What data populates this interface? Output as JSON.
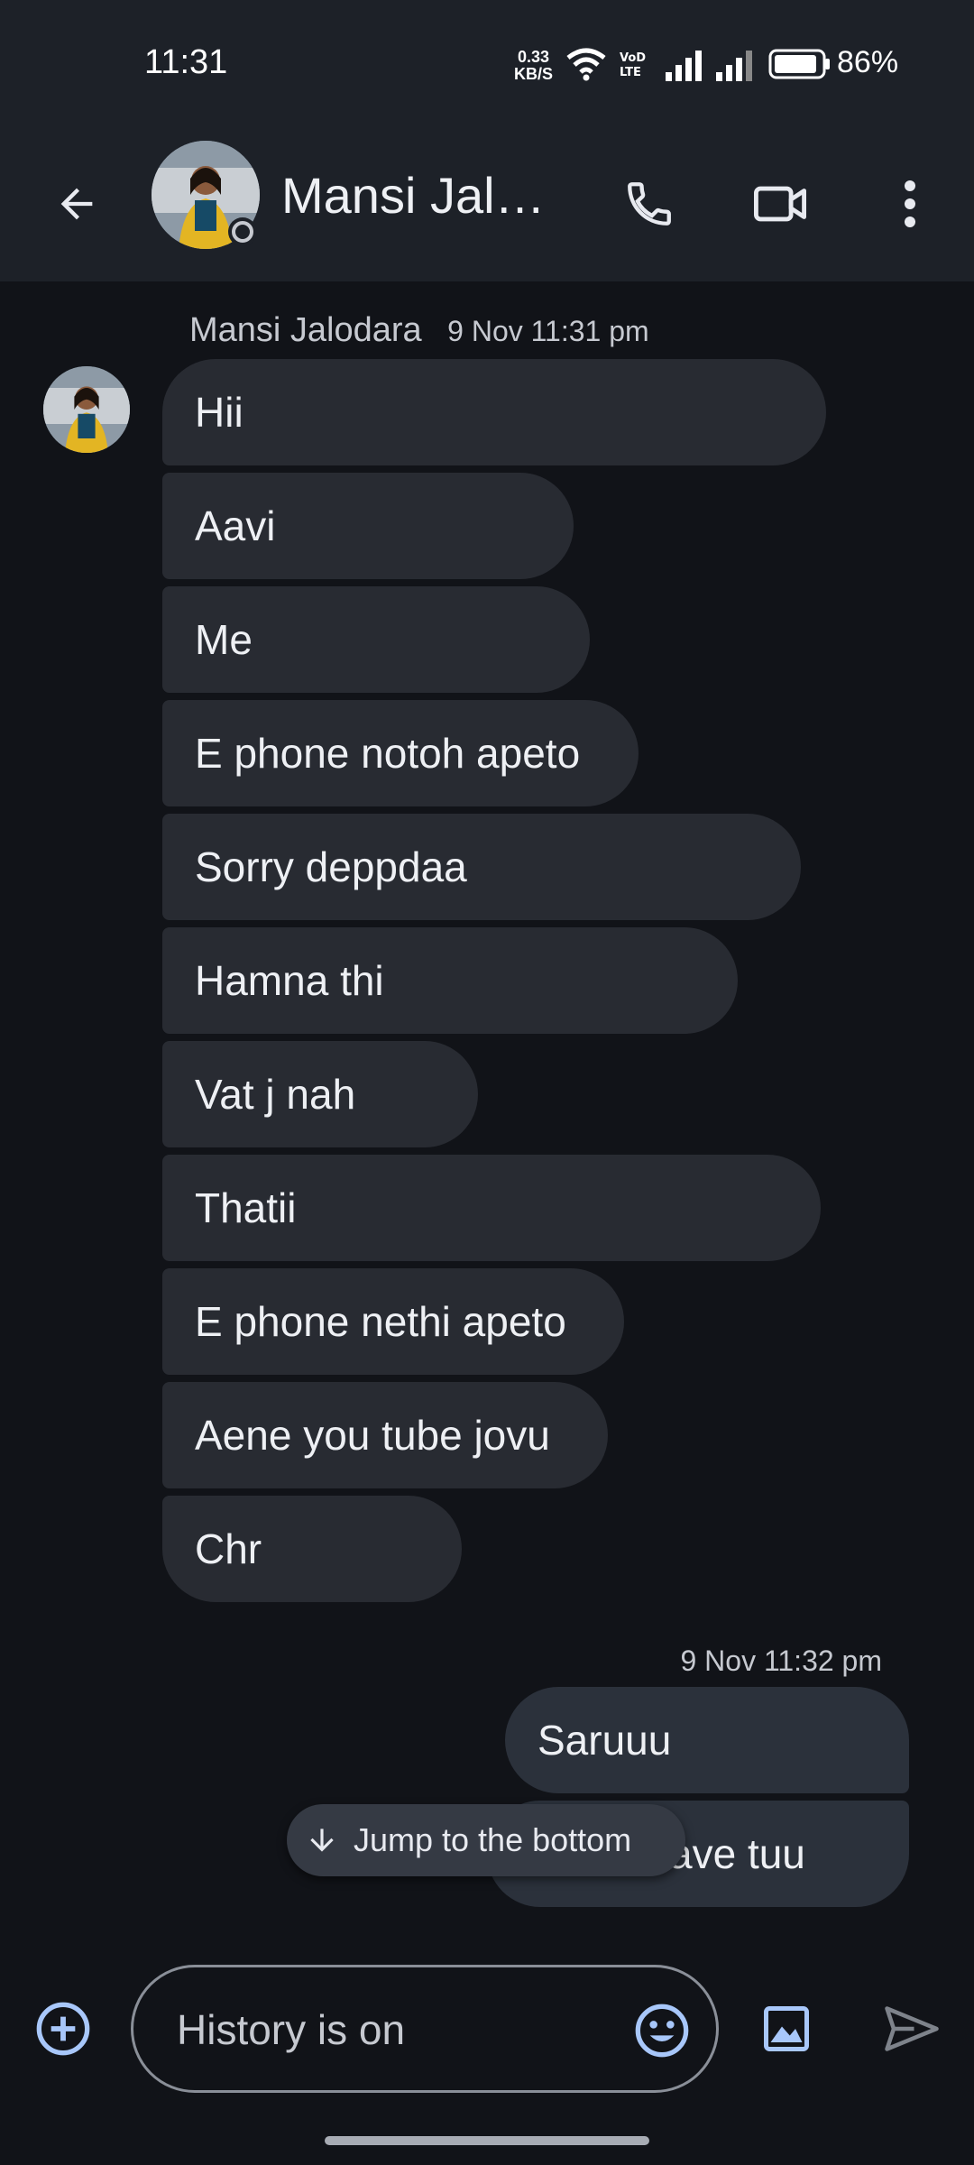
{
  "status_bar": {
    "time": "11:31",
    "net_speed_value": "0.33",
    "net_speed_unit": "KB/S",
    "battery": "86%"
  },
  "header": {
    "contact_name": "Mansi Jalodara",
    "back_icon": "arrow-back-icon",
    "call_icon": "phone-icon",
    "video_icon": "video-camera-icon",
    "more_icon": "more-vert-icon"
  },
  "thread": {
    "incoming_sender": "Mansi Jalodara",
    "incoming_timestamp": "9 Nov 11:31 pm",
    "incoming_messages": [
      "Hii",
      "Aavi",
      "Me",
      "E phone notoh apeto",
      "Sorry deppdaa",
      "Hamna thi",
      "Vat j nah",
      "Thatii",
      "E phone nethi apeto",
      "Aene you tube jovu",
      "Chr"
    ],
    "outgoing_timestamp": "9 Nov 11:32 pm",
    "outgoing_messages": [
      "Saruuu",
      "ave tuu"
    ]
  },
  "jump_button": {
    "label": "Jump to the bottom",
    "icon": "arrow-down-icon"
  },
  "composer": {
    "placeholder": "History is on",
    "value": "",
    "add_icon": "add-circle-icon",
    "emoji_icon": "emoji-icon",
    "gallery_icon": "image-icon",
    "send_icon": "send-icon"
  },
  "colors": {
    "background": "#111318",
    "header": "#1d2128",
    "incoming_bubble": "#282b32",
    "outgoing_bubble": "#2b313b",
    "accent": "#a8c7fa"
  }
}
